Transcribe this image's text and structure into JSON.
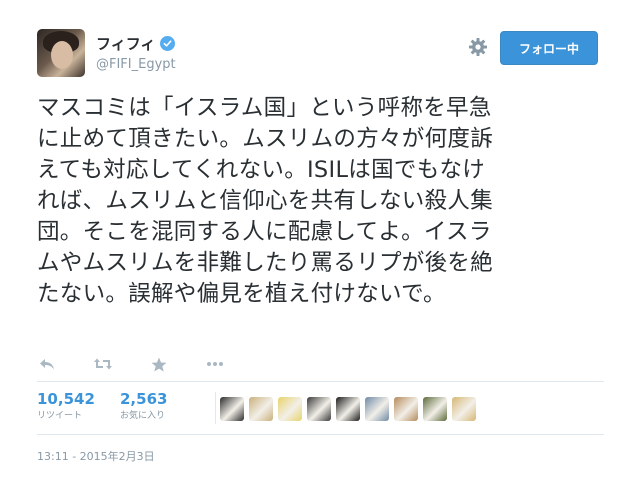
{
  "user": {
    "name": "フィフィ",
    "handle": "@FIFI_Egypt",
    "verified": true,
    "verified_icon": "verified-badge-icon"
  },
  "header": {
    "follow_label": "フォロー中",
    "settings_icon": "gear-icon"
  },
  "tweet": {
    "text": "マスコミは「イスラム国」という呼称を早急\nに止めて頂きたい。ムスリムの方々が何度訴\nえても対応してくれない。ISILは国でもなけ\nれば、ムスリムと信仰心を共有しない殺人集\n団。そこを混同する人に配慮してよ。イスラ\nムやムスリムを非難したり罵るリプが後を絶\nたない。誤解や偏見を植え付けないで。"
  },
  "actions": [
    {
      "name": "reply",
      "icon": "reply-icon"
    },
    {
      "name": "retweet",
      "icon": "retweet-icon"
    },
    {
      "name": "favorite",
      "icon": "star-icon"
    },
    {
      "name": "more",
      "icon": "more-icon"
    }
  ],
  "stats": {
    "retweets": {
      "count": "10,542",
      "label": "リツイート"
    },
    "favorites": {
      "count": "2,563",
      "label": "お気に入り"
    }
  },
  "favoriter_colors": [
    "#2b2b2b",
    "#c9b07a",
    "#e8d36a",
    "#3a3a3a",
    "#1c1c1c",
    "#6f8aa6",
    "#b58a5a",
    "#5d6b3a",
    "#d6b774"
  ],
  "timestamp": "13:11 - 2015年2月3日",
  "colors": {
    "accent": "#3b94d9",
    "text": "#292f33",
    "muted": "#8899a6",
    "action_icons": "#aab8c2"
  }
}
